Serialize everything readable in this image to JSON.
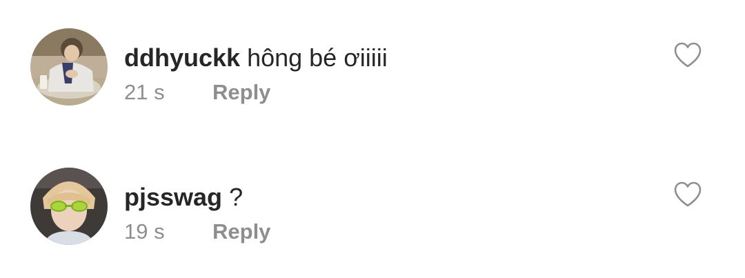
{
  "comments": [
    {
      "username": "ddhyuckk",
      "text": "hông bé ơiiiii",
      "time": "21 s",
      "reply_label": "Reply",
      "avatar_icon": "user-avatar-photo",
      "like_icon": "heart-outline-icon"
    },
    {
      "username": "pjsswag",
      "text": "?",
      "time": "19 s",
      "reply_label": "Reply",
      "avatar_icon": "user-avatar-photo",
      "like_icon": "heart-outline-icon"
    }
  ],
  "colors": {
    "primary_text": "#262626",
    "secondary_text": "#8e8e8e",
    "background": "#ffffff"
  }
}
